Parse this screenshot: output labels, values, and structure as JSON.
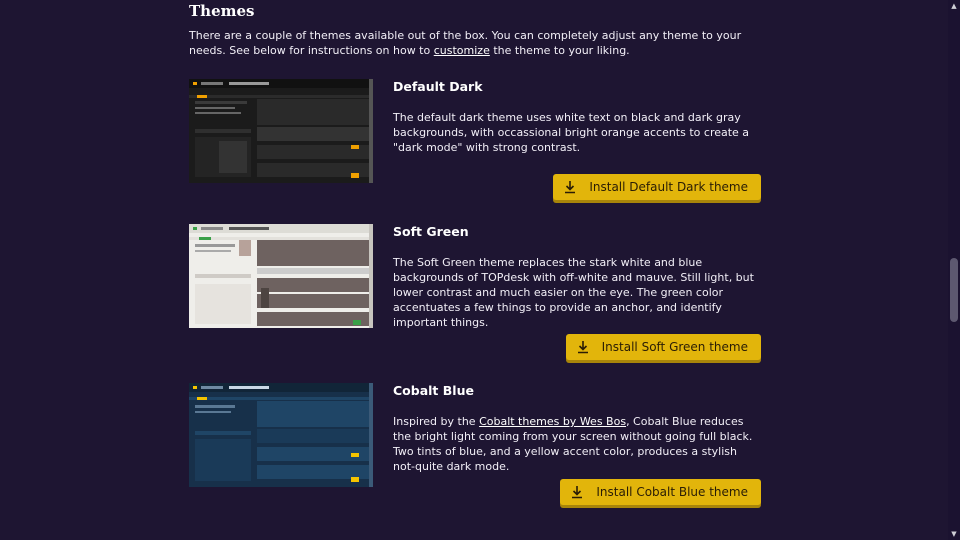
{
  "heading": "Themes",
  "intro": {
    "before": "There are a couple of themes available out of the box. You can completely adjust any theme to your needs. See below for instructions on how to ",
    "link": "customize",
    "after": " the theme to your liking."
  },
  "themes": [
    {
      "title": "Default Dark",
      "description": "The default dark theme uses white text on black and dark gray backgrounds, with occassional bright orange accents to create a \"dark mode\" with strong contrast.",
      "button_label": "Install Default Dark theme",
      "preview_colors": {
        "bg": "#1b1b1b",
        "panel": "#2a2a2a",
        "accent": "#f0a000",
        "text": "#cfcfcf"
      }
    },
    {
      "title": "Soft Green",
      "description": "The Soft Green theme replaces the stark white and blue backgrounds of TOPdesk with off-white and mauve. Still light, but lower contrast and much easier on the eye. The green color accentuates a few things to provide an anchor, and identify important things.",
      "button_label": "Install Soft Green theme",
      "preview_colors": {
        "bg": "#efeeea",
        "panel": "#6e6260",
        "accent": "#3aa048",
        "text": "#444444"
      }
    },
    {
      "title": "Cobalt Blue",
      "description_before": "Inspired by the ",
      "description_link": "Cobalt themes by Wes Bos",
      "description_after": ", Cobalt Blue reduces the bright light coming from your screen without going full black. Two tints of blue, and a yellow accent color, produces a stylish not-quite dark mode.",
      "button_label": "Install Cobalt Blue theme",
      "preview_colors": {
        "bg": "#17304a",
        "panel": "#1f4566",
        "accent": "#f5c400",
        "text": "#c9d8e6"
      }
    }
  ],
  "icons": {
    "download": "download-icon"
  }
}
